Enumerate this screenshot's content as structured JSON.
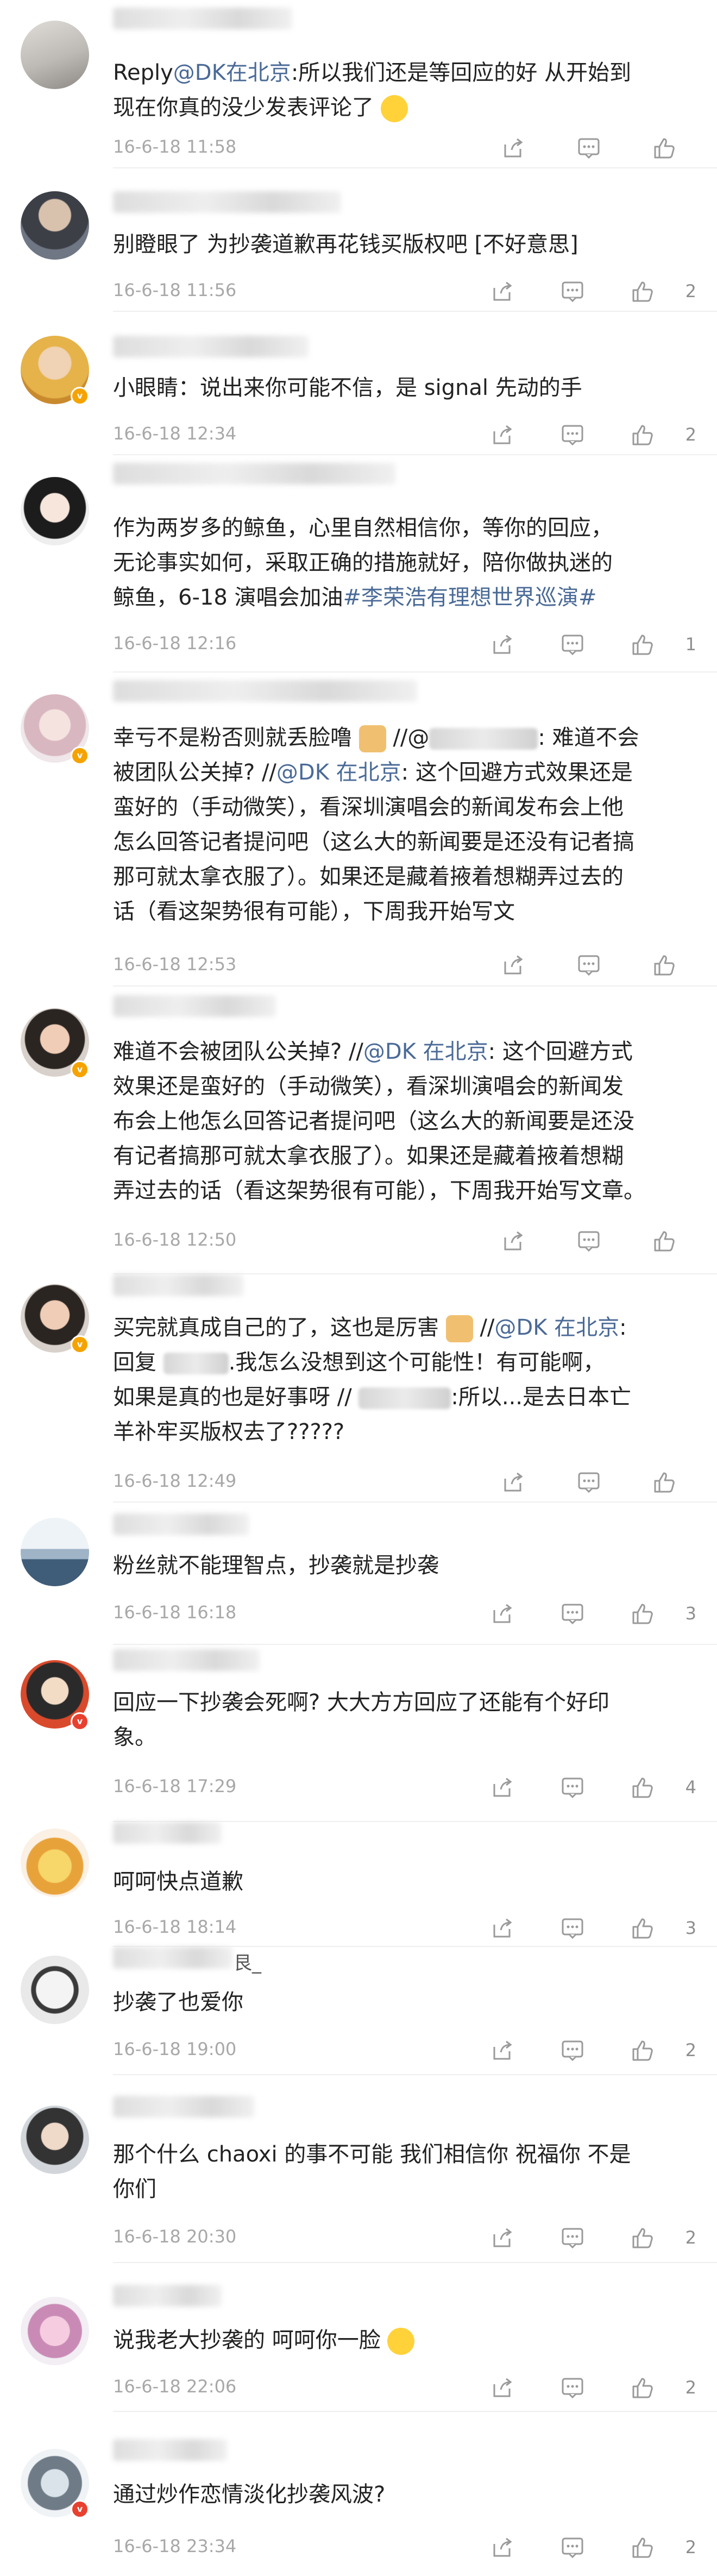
{
  "comments": [
    {
      "id": 1,
      "top": 0,
      "avatar_color": "#c9c9c9",
      "text_lines": [
        "Reply@DK在北京:所以我们还是等回应的好 从开始到",
        "现在你真的没少发表评论了"
      ],
      "mention": "@DK在北京",
      "time": "16-6-18 11:58",
      "likes": ""
    },
    {
      "id": 2,
      "time": "16-6-18 11:56",
      "text_lines": [
        "别瞪眼了 为抄袭道歉再花钱买版权吧 [不好意思]"
      ],
      "likes": "2"
    },
    {
      "id": 3,
      "time": "16-6-18 12:34",
      "text_lines": [
        "小眼睛：说出来你可能不信，是 signal 先动的手"
      ],
      "likes": "2"
    },
    {
      "id": 4,
      "time": "16-6-18 12:16",
      "text_lines": [
        "作为两岁多的鲸鱼，心里自然相信你，等你的回应，",
        "无论事实如何，采取正确的措施就好，陪你做执迷的",
        "鲸鱼，6-18 演唱会加油#李荣浩有理想世界巡演#"
      ],
      "hashtag": "#李荣浩有理想世界巡演#",
      "likes": "1"
    },
    {
      "id": 5,
      "time": "16-6-18 12:53",
      "text_lines": [
        "幸亏不是粉否则就丢脸噜",
        "被团队公关掉? //@DK 在北京: 这个回避方式效果还是",
        "蛮好的（手动微笑），看深圳演唱会的新闻发布会上他",
        "怎么回答记者提问吧（这么大的新闻要是还没有记者搞",
        "那可就太拿衣服了）。如果还是藏着掖着想糊弄过去的",
        "话（看这架势很有可能），下周我开始写文"
      ],
      "inline_1": "//@",
      "inline_2": ": 难道不会",
      "mention": "@DK 在北京",
      "likes": ""
    },
    {
      "id": 6,
      "time": "16-6-18 12:50",
      "text_lines": [
        "难道不会被团队公关掉? //@DK 在北京: 这个回避方式",
        "效果还是蛮好的（手动微笑），看深圳演唱会的新闻发",
        "布会上他怎么回答记者提问吧（这么大的新闻要是还没",
        "有记者搞那可就太拿衣服了）。如果还是藏着掖着想糊",
        "弄过去的话（看这架势很有可能），下周我开始写文章。"
      ],
      "mention": "@DK 在北京",
      "likes": ""
    },
    {
      "id": 7,
      "time": "16-6-18 12:49",
      "text_lines": [
        "买完就真成自己的了，这也是厉害",
        "//@DK 在北京:",
        "回复",
        ".我怎么没想到这个可能性！有可能啊，",
        "如果是真的也是好事呀 //",
        ":所以...是去日本亡",
        "羊补牢买版权去了?????"
      ],
      "mention": "@DK 在北京",
      "likes": ""
    },
    {
      "id": 8,
      "time": "16-6-18 16:18",
      "text_lines": [
        "粉丝就不能理智点，抄袭就是抄袭"
      ],
      "likes": "3"
    },
    {
      "id": 9,
      "time": "16-6-18 17:29",
      "text_lines": [
        "回应一下抄袭会死啊? 大大方方回应了还能有个好印",
        "象。"
      ],
      "likes": "4"
    },
    {
      "id": 10,
      "time": "16-6-18 18:14",
      "text_lines": [
        "呵呵快点道歉"
      ],
      "likes": "3"
    },
    {
      "id": 11,
      "time": "16-6-18 19:00",
      "text_lines": [
        "抄袭了也爱你"
      ],
      "name_fragment": "艮_",
      "likes": "2"
    },
    {
      "id": 12,
      "time": "16-6-18 20:30",
      "text_lines": [
        "那个什么 chaoxi 的事不可能 我们相信你 祝福你 不是",
        "你们"
      ],
      "likes": "2"
    },
    {
      "id": 13,
      "time": "16-6-18 22:06",
      "text_lines": [
        "说我老大抄袭的 呵呵你一脸"
      ],
      "likes": "2"
    },
    {
      "id": 14,
      "time": "16-6-18 23:34",
      "text_lines": [
        "通过炒作恋情淡化抄袭风波?"
      ],
      "likes": "2"
    }
  ],
  "colors": {
    "link": "#4a6a97",
    "time": "#a8a8a8",
    "icon": "#9a9a9a",
    "badge_gold": "#f5a300",
    "badge_red": "#e8412f"
  },
  "icons": [
    "share-icon",
    "comment-icon",
    "like-icon"
  ]
}
